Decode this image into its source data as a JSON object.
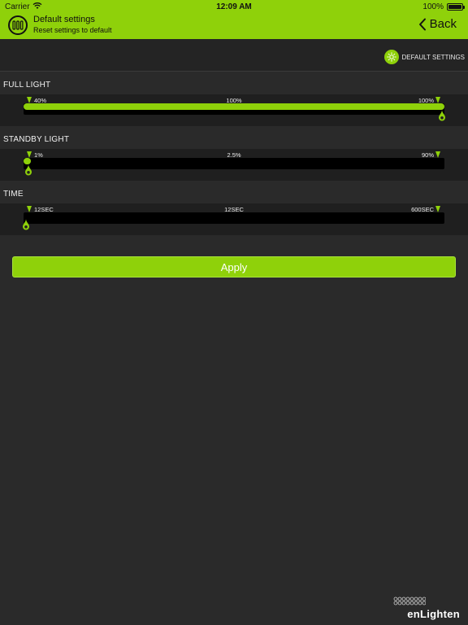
{
  "status_bar": {
    "carrier": "Carrier",
    "time": "12:09 AM",
    "battery": "100%"
  },
  "nav": {
    "title": "Default settings",
    "subtitle": "Reset settings to default",
    "back_label": "Back"
  },
  "toolbar": {
    "default_settings_label": "DEFAULT SETTINGS"
  },
  "sections": [
    {
      "title": "FULL LIGHT",
      "min_label": "40%",
      "current_label": "100%",
      "max_label": "100%",
      "level": 1.0
    },
    {
      "title": "STANDBY LIGHT",
      "min_label": "1%",
      "current_label": "2.5%",
      "max_label": "90%",
      "level": 0.017
    },
    {
      "title": "TIME",
      "min_label": "12SEC",
      "current_label": "12SEC",
      "max_label": "600SEC",
      "level": 0.0
    }
  ],
  "apply_label": "Apply",
  "brand": {
    "name": "enLighten"
  },
  "colors": {
    "accent": "#8fd10a",
    "background": "#2a2a2a",
    "track": "#000000"
  },
  "icons": {
    "logo": "enlighten-logo-icon",
    "back": "chevron-left-icon",
    "sun": "sun-icon",
    "wifi": "wifi-icon",
    "battery": "battery-icon"
  }
}
